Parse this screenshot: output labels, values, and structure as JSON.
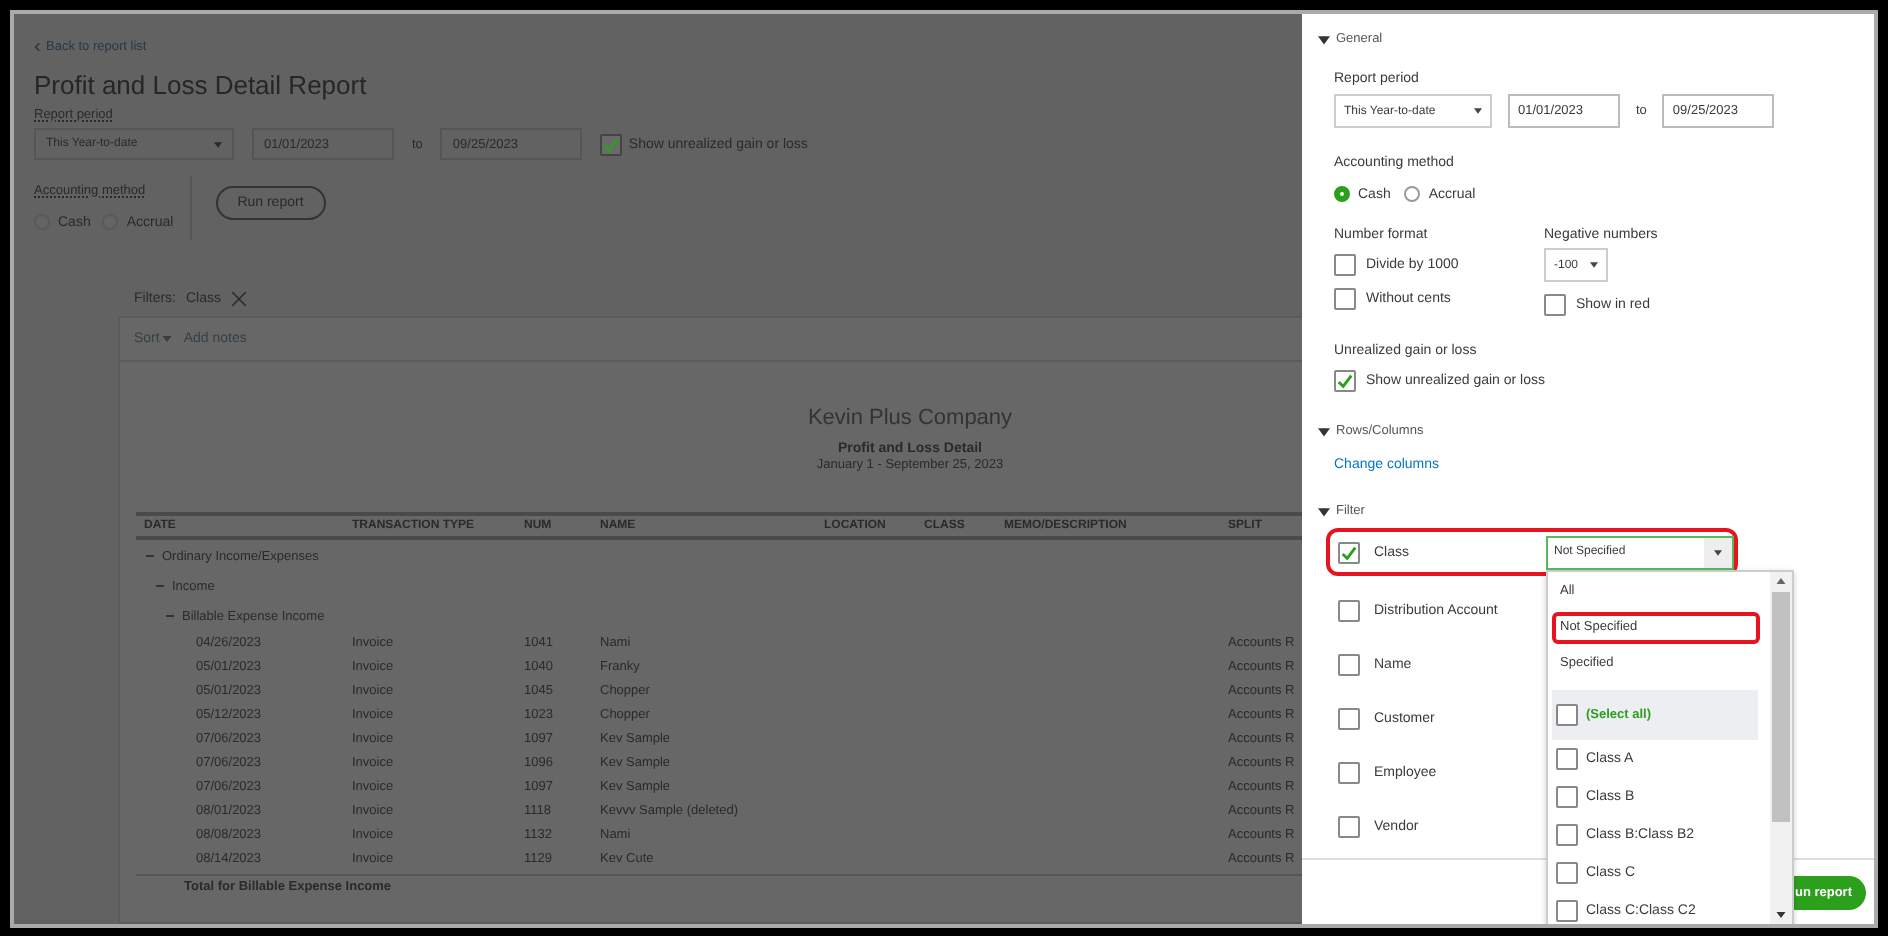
{
  "left": {
    "back_link": "Back to report list",
    "title": "Profit and Loss Detail Report",
    "report_period": {
      "label": "Report period",
      "preset": "This Year-to-date",
      "from": "01/01/2023",
      "to_label": "to",
      "to": "09/25/2023"
    },
    "unrealized": {
      "label": "Show unrealized gain or loss",
      "checked": true
    },
    "accounting_method": {
      "label": "Accounting method",
      "options": [
        {
          "label": "Cash",
          "selected": false
        },
        {
          "label": "Accrual",
          "selected": false
        }
      ]
    },
    "run_button": "Run report",
    "filters": {
      "label": "Filters:",
      "chips": [
        {
          "label": "Class"
        }
      ]
    },
    "toolbar": {
      "sort": "Sort",
      "add_notes": "Add notes"
    },
    "report": {
      "company": "Kevin Plus Company",
      "title": "Profit and Loss Detail",
      "period": "January 1 - September 25, 2023",
      "columns": [
        "DATE",
        "TRANSACTION TYPE",
        "NUM",
        "NAME",
        "LOCATION",
        "CLASS",
        "MEMO/DESCRIPTION",
        "SPLIT"
      ],
      "sections": [
        {
          "label": "Ordinary Income/Expenses",
          "expanded": true,
          "children": [
            {
              "label": "Income",
              "expanded": true,
              "children": [
                {
                  "label": "Billable Expense Income",
                  "expanded": true,
                  "rows": [
                    {
                      "date": "04/26/2023",
                      "type": "Invoice",
                      "num": "1041",
                      "name": "Nami",
                      "split": "Accounts R"
                    },
                    {
                      "date": "05/01/2023",
                      "type": "Invoice",
                      "num": "1040",
                      "name": "Franky",
                      "split": "Accounts R"
                    },
                    {
                      "date": "05/01/2023",
                      "type": "Invoice",
                      "num": "1045",
                      "name": "Chopper",
                      "split": "Accounts R"
                    },
                    {
                      "date": "05/12/2023",
                      "type": "Invoice",
                      "num": "1023",
                      "name": "Chopper",
                      "split": "Accounts R"
                    },
                    {
                      "date": "07/06/2023",
                      "type": "Invoice",
                      "num": "1097",
                      "name": "Kev Sample",
                      "split": "Accounts R"
                    },
                    {
                      "date": "07/06/2023",
                      "type": "Invoice",
                      "num": "1096",
                      "name": "Kev Sample",
                      "split": "Accounts R"
                    },
                    {
                      "date": "07/06/2023",
                      "type": "Invoice",
                      "num": "1097",
                      "name": "Kev Sample",
                      "split": "Accounts R"
                    },
                    {
                      "date": "08/01/2023",
                      "type": "Invoice",
                      "num": "1118",
                      "name": "Kevvv Sample (deleted)",
                      "split": "Accounts R"
                    },
                    {
                      "date": "08/08/2023",
                      "type": "Invoice",
                      "num": "1132",
                      "name": "Nami",
                      "split": "Accounts R"
                    },
                    {
                      "date": "08/14/2023",
                      "type": "Invoice",
                      "num": "1129",
                      "name": "Kev Cute",
                      "split": "Accounts R"
                    }
                  ],
                  "total": "Total for Billable Expense Income"
                }
              ]
            }
          ]
        }
      ]
    }
  },
  "panel": {
    "general": {
      "title": "General",
      "expanded": true,
      "report_period": {
        "label": "Report period",
        "preset": "This Year-to-date",
        "from": "01/01/2023",
        "to_label": "to",
        "to": "09/25/2023"
      },
      "accounting_method": {
        "label": "Accounting method",
        "options": [
          {
            "label": "Cash",
            "selected": true
          },
          {
            "label": "Accrual",
            "selected": false
          }
        ]
      },
      "number_format": {
        "label": "Number format",
        "options": [
          {
            "label": "Divide by 1000",
            "checked": false
          },
          {
            "label": "Without cents",
            "checked": false
          }
        ]
      },
      "negative_numbers": {
        "label": "Negative numbers",
        "value": "-100",
        "show_in_red": {
          "label": "Show in red",
          "checked": false
        }
      },
      "unrealized": {
        "label": "Unrealized gain or loss",
        "option": {
          "label": "Show unrealized gain or loss",
          "checked": true
        }
      }
    },
    "rows_columns": {
      "title": "Rows/Columns",
      "expanded": true,
      "link": "Change columns"
    },
    "filter": {
      "title": "Filter",
      "expanded": true,
      "items": [
        {
          "label": "Class",
          "checked": true,
          "highlighted": true,
          "value": "Not Specified"
        },
        {
          "label": "Distribution Account",
          "checked": false,
          "highlighted": false
        },
        {
          "label": "Name",
          "checked": false,
          "highlighted": false
        },
        {
          "label": "Customer",
          "checked": false,
          "highlighted": false
        },
        {
          "label": "Employee",
          "checked": false,
          "highlighted": false
        },
        {
          "label": "Vendor",
          "checked": false,
          "highlighted": false
        }
      ]
    },
    "dropdown": {
      "options": [
        {
          "label": "All",
          "highlighted": false
        },
        {
          "label": "Not Specified",
          "highlighted": true
        },
        {
          "label": "Specified",
          "highlighted": false
        }
      ],
      "checklist": [
        {
          "label": "(Select all)",
          "kind": "select-all",
          "checked": false
        },
        {
          "label": "Class A",
          "kind": "item",
          "checked": false
        },
        {
          "label": "Class B",
          "kind": "item",
          "checked": false
        },
        {
          "label": "Class B:Class B2",
          "kind": "item",
          "checked": false
        },
        {
          "label": "Class C",
          "kind": "item",
          "checked": false
        },
        {
          "label": "Class C:Class C2",
          "kind": "item",
          "checked": false
        }
      ]
    },
    "run_button": "un report"
  }
}
